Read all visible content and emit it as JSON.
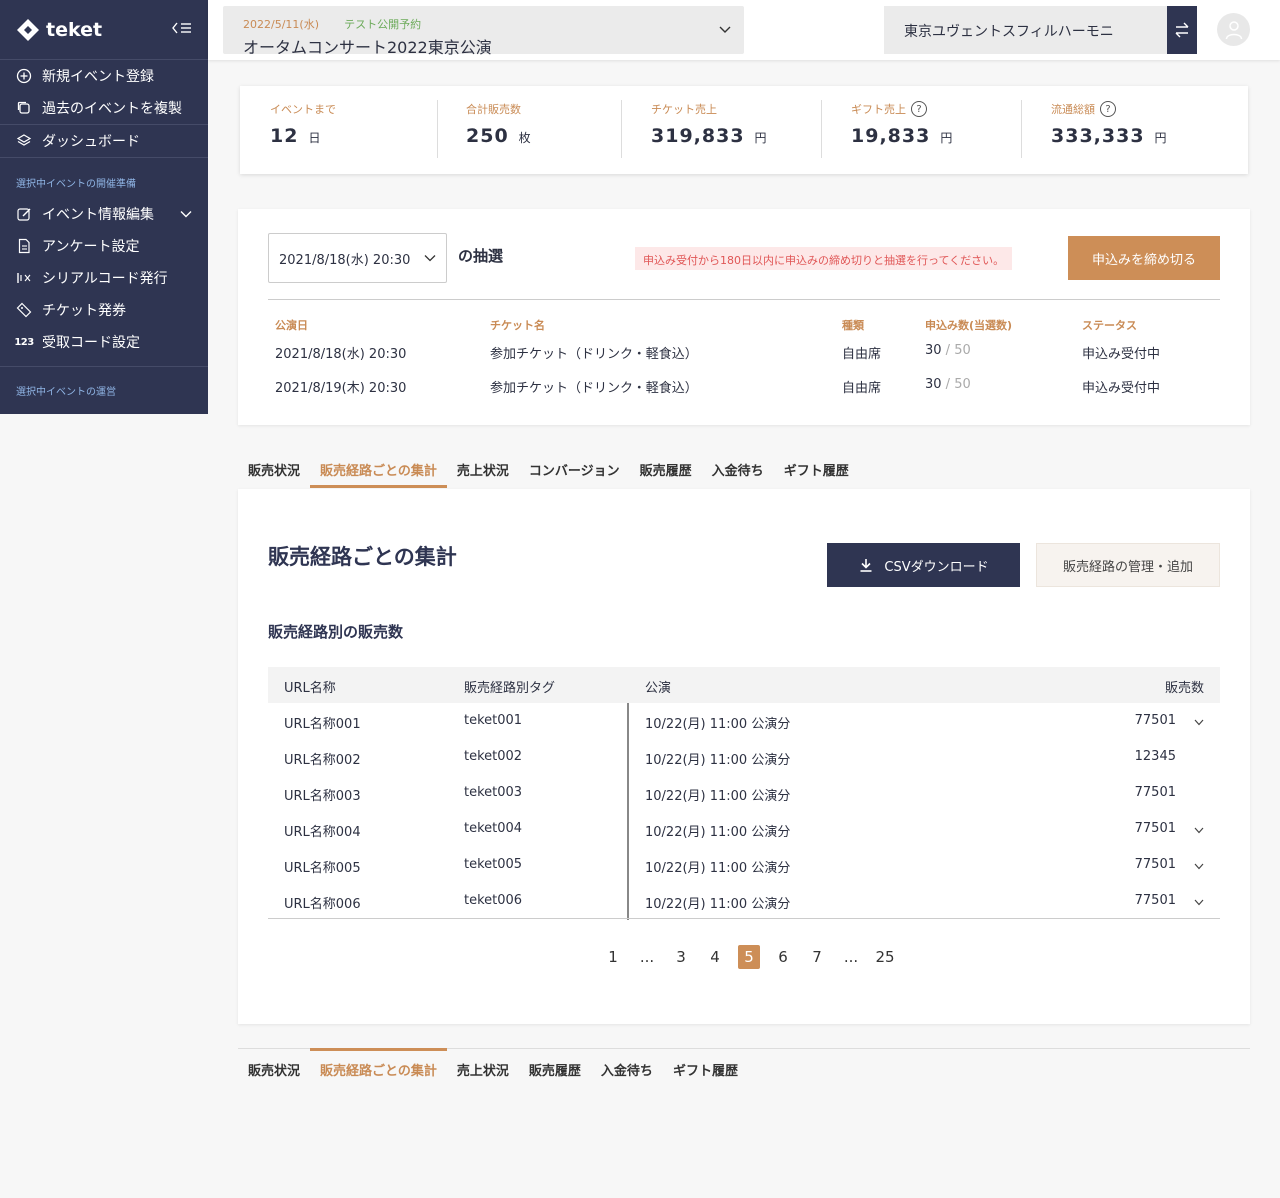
{
  "sidebar": {
    "brand": "teket",
    "items_top": [
      {
        "label": "新規イベント登録",
        "icon": "plus-circle-icon"
      },
      {
        "label": "過去のイベントを複製",
        "icon": "copy-icon"
      },
      {
        "label": "ダッシュボード",
        "icon": "layers-icon"
      }
    ],
    "section1": "選択中イベントの開催準備",
    "items_prep": [
      {
        "label": "イベント情報編集",
        "icon": "edit-icon"
      },
      {
        "label": "アンケート設定",
        "icon": "document-icon"
      },
      {
        "label": "シリアルコード発行",
        "icon": "serial-icon"
      },
      {
        "label": "チケット発券",
        "icon": "ticket-icon"
      },
      {
        "label": "受取コード設定",
        "icon": "number-icon",
        "glyph": "123"
      }
    ],
    "section2": "選択中イベントの運営"
  },
  "header": {
    "event_date": "2022/5/11(水)",
    "event_status": "テスト公開予約",
    "event_name": "オータムコンサート2022東京公演",
    "organization": "東京ユヴェントスフィルハーモニ"
  },
  "stats": [
    {
      "label": "イベントまで",
      "value": "12",
      "unit": "日",
      "help": false
    },
    {
      "label": "合計販売数",
      "value": "250",
      "unit": "枚",
      "help": false
    },
    {
      "label": "チケット売上",
      "value": "319,833",
      "unit": "円",
      "help": false
    },
    {
      "label": "ギフト売上",
      "value": "19,833",
      "unit": "円",
      "help": true
    },
    {
      "label": "流通総額",
      "value": "333,333",
      "unit": "円",
      "help": true
    }
  ],
  "lottery": {
    "selected_date": "2021/8/18(水) 20:30",
    "title": "の抽選",
    "warning": "申込み受付から180日以内に申込みの締め切りと抽選を行ってください。",
    "close_button": "申込みを締め切る",
    "headers": [
      "公演日",
      "チケット名",
      "種類",
      "申込み数(当選数)",
      "ステータス"
    ],
    "rows": [
      {
        "date": "2021/8/18(水) 20:30",
        "ticket": "参加チケット（ドリンク・軽食込）",
        "type": "自由席",
        "count": "30",
        "total": " / 50",
        "status": "申込み受付中"
      },
      {
        "date": "2021/8/19(木) 20:30",
        "ticket": "参加チケット（ドリンク・軽食込）",
        "type": "自由席",
        "count": "30",
        "total": " / 50",
        "status": "申込み受付中"
      }
    ]
  },
  "tabs_top": [
    "販売状況",
    "販売経路ごとの集計",
    "売上状況",
    "コンバージョン",
    "販売履歴",
    "入金待ち",
    "ギフト履歴"
  ],
  "tabs_bottom": [
    "販売状況",
    "販売経路ごとの集計",
    "売上状況",
    "販売履歴",
    "入金待ち",
    "ギフト履歴"
  ],
  "active_tab": "販売経路ごとの集計",
  "panel": {
    "title": "販売経路ごとの集計",
    "csv_button": "CSVダウンロード",
    "route_button": "販売経路の管理・追加",
    "subtitle": "販売経路別の販売数",
    "columns": [
      "URL名称",
      "販売経路別タグ",
      "公演",
      "販売数"
    ],
    "rows": [
      {
        "name": "URL名称001",
        "tag": "teket001",
        "show": "10/22(月) 11:00 公演分",
        "count": "77501",
        "expand": true
      },
      {
        "name": "URL名称002",
        "tag": "teket002",
        "show": "10/22(月) 11:00 公演分",
        "count": "12345",
        "expand": false
      },
      {
        "name": "URL名称003",
        "tag": "teket003",
        "show": "10/22(月) 11:00 公演分",
        "count": "77501",
        "expand": false
      },
      {
        "name": "URL名称004",
        "tag": "teket004",
        "show": "10/22(月) 11:00 公演分",
        "count": "77501",
        "expand": true
      },
      {
        "name": "URL名称005",
        "tag": "teket005",
        "show": "10/22(月) 11:00 公演分",
        "count": "77501",
        "expand": true
      },
      {
        "name": "URL名称006",
        "tag": "teket006",
        "show": "10/22(月) 11:00 公演分",
        "count": "77501",
        "expand": true
      }
    ]
  },
  "pagination": {
    "pages": [
      "1",
      "...",
      "3",
      "4",
      "5",
      "6",
      "7",
      "...",
      "25"
    ],
    "current": "5"
  },
  "colors": {
    "navy": "#2f3552",
    "accent": "#cd8e57",
    "warn": "#e05656",
    "status_green": "#6dab5b"
  }
}
